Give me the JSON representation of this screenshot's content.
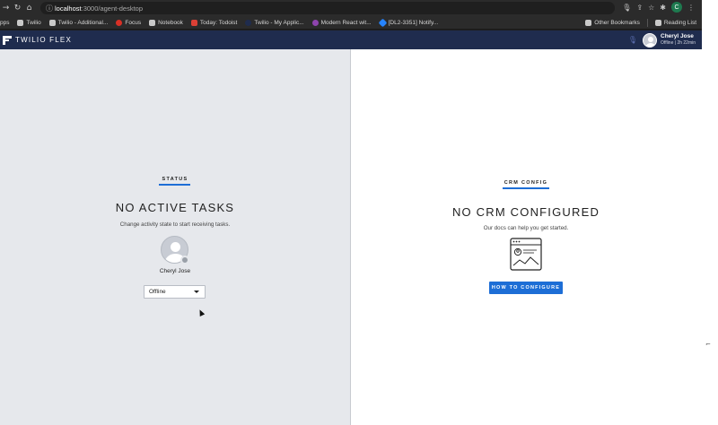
{
  "browser": {
    "url_host": "localhost",
    "url_path": ":3000/agent-desktop",
    "profile_initial": "C",
    "bookmarks": [
      {
        "label": "pps",
        "color": "#2b2b2b"
      },
      {
        "label": "Twilio",
        "color": "#c9c9c9"
      },
      {
        "label": "Twilio - Additional...",
        "color": "#c9c9c9"
      },
      {
        "label": "Focus",
        "color": "#d93025"
      },
      {
        "label": "Notebook",
        "color": "#c9c9c9"
      },
      {
        "label": "Today: Todoist",
        "color": "#db4035"
      },
      {
        "label": "Twilio - My Applic...",
        "color": "#1f2c4e"
      },
      {
        "label": "Modern React wit...",
        "color": "#8e44ad"
      },
      {
        "label": "[DL2-3351] Notify...",
        "color": "#2684ff"
      }
    ],
    "other_bookmarks": "Other Bookmarks",
    "reading_list": "Reading List"
  },
  "flex": {
    "title": "TWILIO FLEX",
    "user_name": "Cheryl Jose",
    "user_status": "Offline | 2h 22min"
  },
  "status_panel": {
    "label": "STATUS",
    "title": "NO ACTIVE TASKS",
    "subtitle": "Change activity state to start receiving tasks.",
    "agent_name": "Cheryl Jose",
    "activity_value": "Offline"
  },
  "crm_panel": {
    "label": "CRM CONFIG",
    "title": "NO CRM CONFIGURED",
    "subtitle": "Our docs can help you get started.",
    "button_label": "HOW TO CONFIGURE"
  },
  "colors": {
    "header_bg": "#1f2c4e",
    "accent": "#1d6ed6",
    "left_panel_bg": "#e6e8ec",
    "right_panel_bg": "#ffffff"
  }
}
